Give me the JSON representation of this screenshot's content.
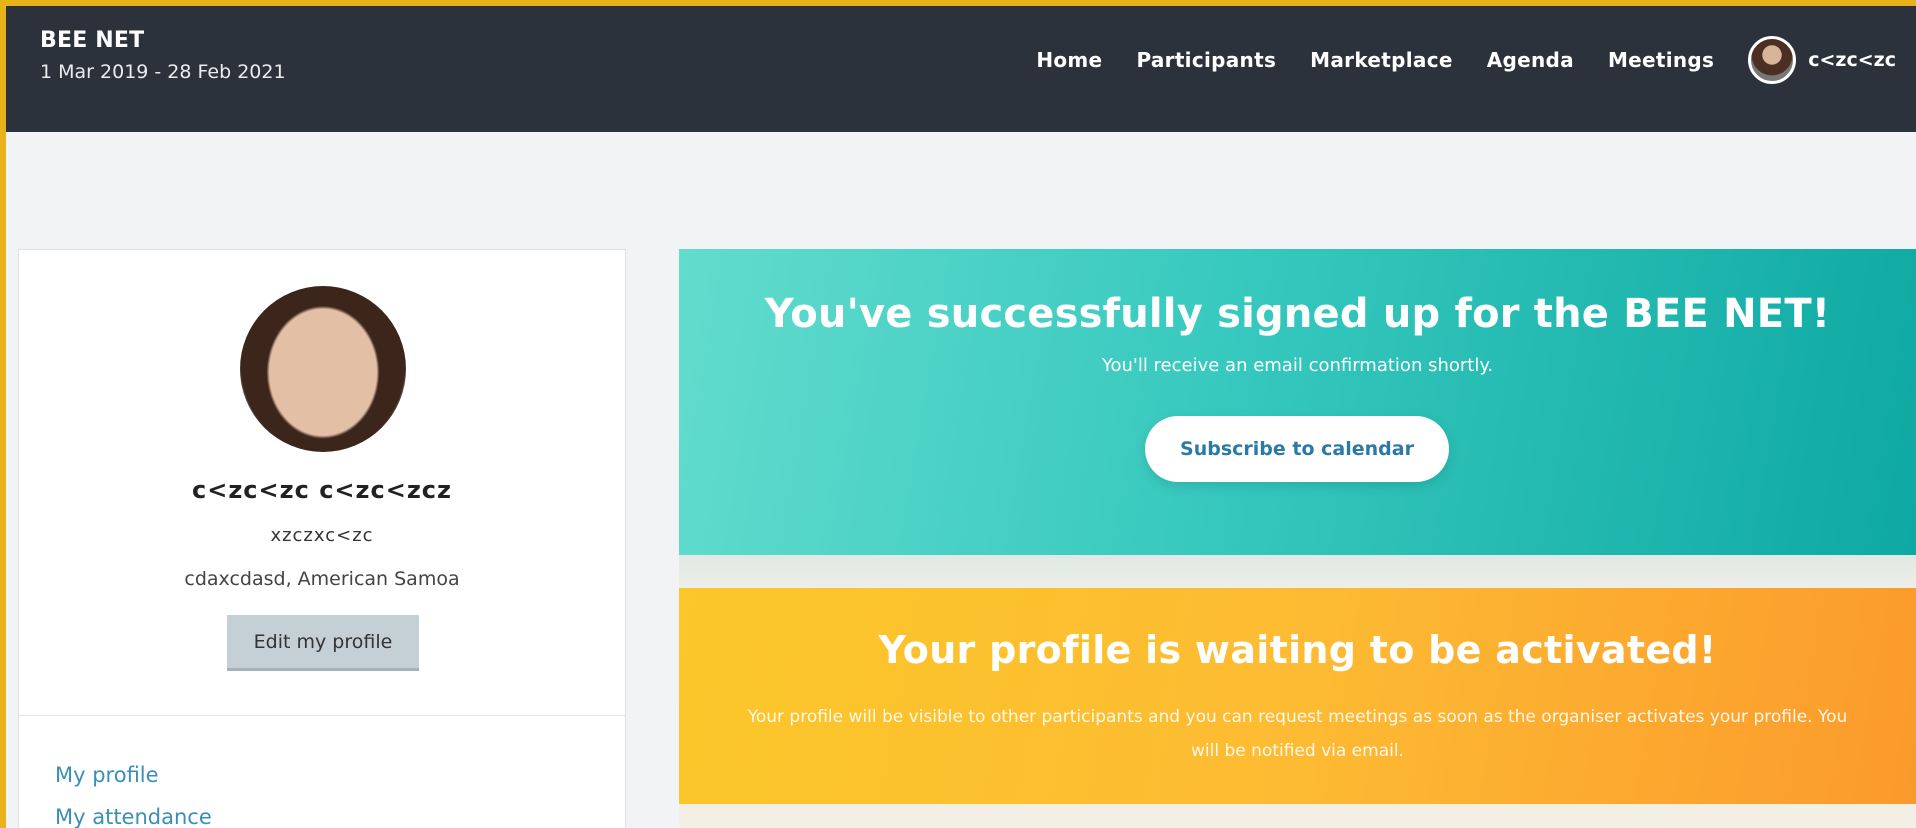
{
  "header": {
    "title": "BEE NET",
    "dates": "1 Mar 2019 - 28 Feb 2021",
    "nav": {
      "home": "Home",
      "participants": "Participants",
      "marketplace": "Marketplace",
      "agenda": "Agenda",
      "meetings": "Meetings"
    },
    "user_name": "c<zc<zc"
  },
  "profile": {
    "full_name": "c<zc<zc c<zc<zcz",
    "organisation": "xzczxc<zc",
    "location": "cdaxcdasd, American Samoa",
    "edit_label": "Edit my profile",
    "links": {
      "my_profile": "My profile",
      "my_attendance": "My attendance"
    }
  },
  "success_banner": {
    "title": "You've successfully signed up for the BEE NET!",
    "subtitle": "You'll receive an email confirmation shortly.",
    "button_label": "Subscribe to calendar"
  },
  "warning_banner": {
    "title": "Your profile is waiting to be activated!",
    "text": "Your profile will be visible to other participants and you can request meetings as soon as the organiser activates your profile. You will be notified via email."
  },
  "colors": {
    "header_bg": "#2c323c",
    "accent_frame": "#e8b21a",
    "link": "#3a8fb7",
    "success_start": "#62dccd",
    "success_end": "#0ea9a2",
    "warning_start": "#fbc72a",
    "warning_end": "#fb9a2c"
  }
}
